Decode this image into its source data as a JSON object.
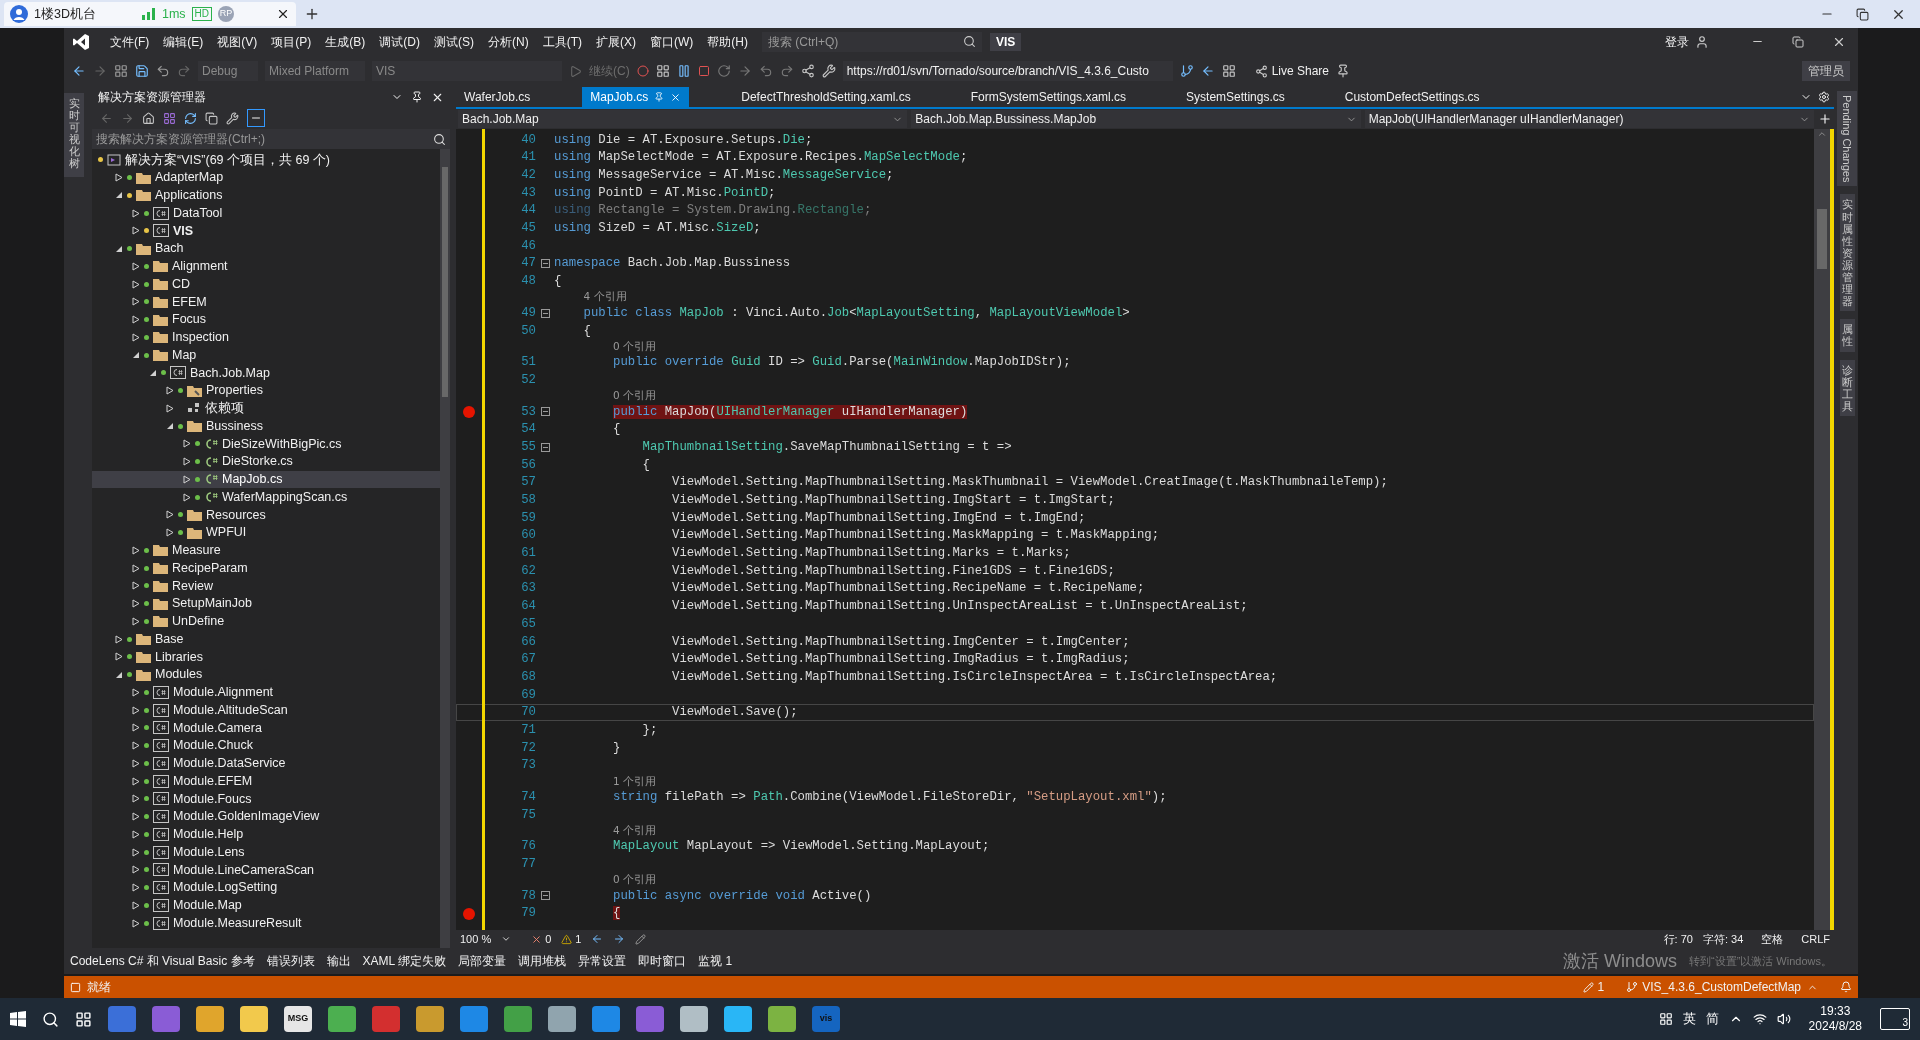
{
  "browser": {
    "tab_title": "1楼3D机台",
    "latency": "1ms",
    "badges": [
      "HD",
      "RP"
    ]
  },
  "menu": {
    "items": [
      "文件(F)",
      "编辑(E)",
      "视图(V)",
      "项目(P)",
      "生成(B)",
      "调试(D)",
      "测试(S)",
      "分析(N)",
      "工具(T)",
      "扩展(X)",
      "窗口(W)",
      "帮助(H)"
    ],
    "search_placeholder": "搜索 (Ctrl+Q)",
    "solution_name": "VIS",
    "login": "登录"
  },
  "toolbar": {
    "configuration": "Debug",
    "platform": "Mixed Platform",
    "startup": "VIS",
    "continue": {
      "label": "继续(C)",
      "disabled": true
    },
    "url": "https://rd01/svn/Tornado/source/branch/VIS_4.3.6_Custo",
    "live_share": "Live Share",
    "admin": "管理员"
  },
  "left_strip": "实时可视化树",
  "solution_explorer": {
    "title": "解决方案资源管理器",
    "search_placeholder": "搜索解决方案资源管理器(Ctrl+;)",
    "tree": [
      {
        "label": "解决方案“VIS”(69 个项目，共 69 个)",
        "kind": "solution",
        "color": "#e8c547",
        "selected": false,
        "children": [
          {
            "label": "AdapterMap",
            "kind": "folder",
            "color": "#6cbf4a",
            "selected": false,
            "expanded": false
          },
          {
            "label": "Applications",
            "kind": "folder",
            "color": "#e8c547",
            "selected": false,
            "expanded": true,
            "children": [
              {
                "label": "DataTool",
                "kind": "project",
                "color": "#6cbf4a",
                "selected": false,
                "expanded": false
              },
              {
                "label": "VIS",
                "kind": "project",
                "color": "#e8c547",
                "selected": false,
                "expanded": false,
                "startup": true
              }
            ]
          },
          {
            "label": "Bach",
            "kind": "folder",
            "color": "#6cbf4a",
            "selected": false,
            "expanded": true,
            "children": [
              {
                "label": "Alignment",
                "kind": "folder",
                "color": "#6cbf4a",
                "selected": false,
                "expanded": false
              },
              {
                "label": "CD",
                "kind": "folder",
                "color": "#6cbf4a",
                "selected": false,
                "expanded": false
              },
              {
                "label": "EFEM",
                "kind": "folder",
                "color": "#6cbf4a",
                "selected": false,
                "expanded": false
              },
              {
                "label": "Focus",
                "kind": "folder",
                "color": "#6cbf4a",
                "selected": false,
                "expanded": false
              },
              {
                "label": "Inspection",
                "kind": "folder",
                "color": "#6cbf4a",
                "selected": false,
                "expanded": false
              },
              {
                "label": "Map",
                "kind": "folder",
                "color": "#6cbf4a",
                "selected": false,
                "expanded": true,
                "children": [
                  {
                    "label": "Bach.Job.Map",
                    "kind": "project",
                    "color": "#6cbf4a",
                    "selected": false,
                    "expanded": true,
                    "children": [
                      {
                        "label": "Properties",
                        "kind": "properties",
                        "color": "#6cbf4a",
                        "selected": false,
                        "expanded": false
                      },
                      {
                        "label": "依赖项",
                        "kind": "deps",
                        "selected": false,
                        "expanded": false
                      },
                      {
                        "label": "Bussiness",
                        "kind": "folder",
                        "color": "#6cbf4a",
                        "selected": false,
                        "expanded": true,
                        "children": [
                          {
                            "label": "DieSizeWithBigPic.cs",
                            "kind": "file",
                            "color": "#6cbf4a",
                            "selected": false,
                            "expanded": false
                          },
                          {
                            "label": "DieStorke.cs",
                            "kind": "file",
                            "color": "#6cbf4a",
                            "selected": false,
                            "expanded": false
                          },
                          {
                            "label": "MapJob.cs",
                            "kind": "file",
                            "color": "#6cbf4a",
                            "selected": true,
                            "expanded": false
                          },
                          {
                            "label": "WaferMappingScan.cs",
                            "kind": "file",
                            "color": "#6cbf4a",
                            "selected": false,
                            "expanded": false
                          }
                        ]
                      },
                      {
                        "label": "Resources",
                        "kind": "folder",
                        "color": "#6cbf4a",
                        "selected": false,
                        "expanded": false
                      },
                      {
                        "label": "WPFUI",
                        "kind": "folder",
                        "color": "#6cbf4a",
                        "selected": false,
                        "expanded": false
                      }
                    ]
                  }
                ]
              },
              {
                "label": "Measure",
                "kind": "folder",
                "color": "#6cbf4a",
                "selected": false,
                "expanded": false
              },
              {
                "label": "RecipeParam",
                "kind": "folder",
                "color": "#6cbf4a",
                "selected": false,
                "expanded": false
              },
              {
                "label": "Review",
                "kind": "folder",
                "color": "#6cbf4a",
                "selected": false,
                "expanded": false
              },
              {
                "label": "SetupMainJob",
                "kind": "folder",
                "color": "#6cbf4a",
                "selected": false,
                "expanded": false
              },
              {
                "label": "UnDefine",
                "kind": "folder",
                "color": "#6cbf4a",
                "selected": false,
                "expanded": false
              }
            ]
          },
          {
            "label": "Base",
            "kind": "folder",
            "color": "#6cbf4a",
            "selected": false,
            "expanded": false
          },
          {
            "label": "Libraries",
            "kind": "folder",
            "color": "#6cbf4a",
            "selected": false,
            "expanded": false
          },
          {
            "label": "Modules",
            "kind": "folder",
            "color": "#6cbf4a",
            "selected": false,
            "expanded": true,
            "children": [
              {
                "label": "Module.Alignment",
                "kind": "project",
                "color": "#6cbf4a",
                "selected": false,
                "expanded": false
              },
              {
                "label": "Module.AltitudeScan",
                "kind": "project",
                "color": "#6cbf4a",
                "selected": false,
                "expanded": false
              },
              {
                "label": "Module.Camera",
                "kind": "project",
                "color": "#6cbf4a",
                "selected": false,
                "expanded": false
              },
              {
                "label": "Module.Chuck",
                "kind": "project",
                "color": "#6cbf4a",
                "selected": false,
                "expanded": false
              },
              {
                "label": "Module.DataService",
                "kind": "project",
                "color": "#6cbf4a",
                "selected": false,
                "expanded": false
              },
              {
                "label": "Module.EFEM",
                "kind": "project",
                "color": "#6cbf4a",
                "selected": false,
                "expanded": false
              },
              {
                "label": "Module.Foucs",
                "kind": "project",
                "color": "#6cbf4a",
                "selected": false,
                "expanded": false
              },
              {
                "label": "Module.GoldenImageView",
                "kind": "project",
                "color": "#6cbf4a",
                "selected": false,
                "expanded": false
              },
              {
                "label": "Module.Help",
                "kind": "project",
                "color": "#6cbf4a",
                "selected": false,
                "expanded": false
              },
              {
                "label": "Module.Lens",
                "kind": "project",
                "color": "#6cbf4a",
                "selected": false,
                "expanded": false
              },
              {
                "label": "Module.LineCameraScan",
                "kind": "project",
                "color": "#6cbf4a",
                "selected": false,
                "expanded": false
              },
              {
                "label": "Module.LogSetting",
                "kind": "project",
                "color": "#6cbf4a",
                "selected": false,
                "expanded": false
              },
              {
                "label": "Module.Map",
                "kind": "project",
                "color": "#6cbf4a",
                "selected": false,
                "expanded": false
              },
              {
                "label": "Module.MeasureResult",
                "kind": "project",
                "color": "#6cbf4a",
                "selected": false,
                "expanded": false
              }
            ]
          }
        ]
      }
    ]
  },
  "editor": {
    "tabs": [
      {
        "label": "WaferJob.cs",
        "selected": false
      },
      {
        "label": "MapJob.cs",
        "selected": true
      },
      {
        "label": "DefectThresholdSetting.xaml.cs",
        "selected": false
      },
      {
        "label": "FormSystemSettings.xaml.cs",
        "selected": false
      },
      {
        "label": "SystemSettings.cs",
        "selected": false
      },
      {
        "label": "CustomDefectSettings.cs",
        "selected": false
      }
    ],
    "nav": [
      "Bach.Job.Map",
      "Bach.Job.Map.Bussiness.MapJob",
      "MapJob(UIHandlerManager uIHandlerManager)"
    ],
    "lines": [
      {
        "num": "40",
        "tokens": [
          {
            "kind": "keyword",
            "text": "using"
          },
          {
            "kind": "plain",
            "text": " Die = AT.Exposure.Setups."
          },
          {
            "kind": "type",
            "text": "Die"
          },
          {
            "kind": "plain",
            "text": ";"
          }
        ]
      },
      {
        "num": "41",
        "tokens": [
          {
            "kind": "keyword",
            "text": "using"
          },
          {
            "kind": "plain",
            "text": " MapSelectMode = AT.Exposure.Recipes."
          },
          {
            "kind": "type",
            "text": "MapSelectMode"
          },
          {
            "kind": "plain",
            "text": ";"
          }
        ]
      },
      {
        "num": "42",
        "tokens": [
          {
            "kind": "keyword",
            "text": "using"
          },
          {
            "kind": "plain",
            "text": " MessageService = AT.Misc."
          },
          {
            "kind": "type",
            "text": "MessageService"
          },
          {
            "kind": "plain",
            "text": ";"
          }
        ]
      },
      {
        "num": "43",
        "tokens": [
          {
            "kind": "keyword",
            "text": "using"
          },
          {
            "kind": "plain",
            "text": " PointD = AT.Misc."
          },
          {
            "kind": "type",
            "text": "PointD"
          },
          {
            "kind": "plain",
            "text": ";"
          }
        ]
      },
      {
        "num": "44",
        "faded": true,
        "tokens": [
          {
            "kind": "keyword",
            "text": "using"
          },
          {
            "kind": "plain",
            "text": " Rectangle = System.Drawing."
          },
          {
            "kind": "type",
            "text": "Rectangle"
          },
          {
            "kind": "plain",
            "text": ";"
          }
        ]
      },
      {
        "num": "45",
        "tokens": [
          {
            "kind": "keyword",
            "text": "using"
          },
          {
            "kind": "plain",
            "text": " SizeD = AT.Misc."
          },
          {
            "kind": "type",
            "text": "SizeD"
          },
          {
            "kind": "plain",
            "text": ";"
          }
        ]
      },
      {
        "num": "46"
      },
      {
        "num": "47",
        "fold": true,
        "tokens": [
          {
            "kind": "keyword",
            "text": "namespace"
          },
          {
            "kind": "plain",
            "text": " Bach.Job.Map.Bussiness"
          }
        ]
      },
      {
        "num": "48",
        "tokens": [
          {
            "kind": "plain",
            "text": "{"
          }
        ]
      },
      {
        "num": "49",
        "refs": "4 个引用",
        "fold": true,
        "tokens": [
          {
            "kind": "keyword",
            "text": "    public class"
          },
          {
            "kind": "type",
            "text": " MapJob"
          },
          {
            "kind": "plain",
            "text": " : Vinci.Auto."
          },
          {
            "kind": "type",
            "text": "Job"
          },
          {
            "kind": "plain",
            "text": "<"
          },
          {
            "kind": "type",
            "text": "MapLayoutSetting"
          },
          {
            "kind": "plain",
            "text": ", "
          },
          {
            "kind": "type",
            "text": "MapLayoutViewModel"
          },
          {
            "kind": "plain",
            "text": ">"
          }
        ]
      },
      {
        "num": "50",
        "tokens": [
          {
            "kind": "plain",
            "text": "    {"
          }
        ]
      },
      {
        "num": "51",
        "refs": "0 个引用",
        "tokens": [
          {
            "kind": "keyword",
            "text": "        public override"
          },
          {
            "kind": "type",
            "text": " Guid"
          },
          {
            "kind": "plain",
            "text": " ID => "
          },
          {
            "kind": "type",
            "text": "Guid"
          },
          {
            "kind": "plain",
            "text": ".Parse("
          },
          {
            "kind": "type",
            "text": "MainWindow"
          },
          {
            "kind": "plain",
            "text": ".MapJobIDStr);"
          }
        ]
      },
      {
        "num": "52"
      },
      {
        "num": "53",
        "refs": "0 个引用",
        "fold": true,
        "breakpoint": true,
        "tokens": [
          {
            "kind": "keyword",
            "text": "        public"
          },
          {
            "kind": "plain",
            "text": " MapJob("
          },
          {
            "kind": "type",
            "text": "UIHandlerManager"
          },
          {
            "kind": "plain",
            "text": " uIHandlerManager)"
          }
        ]
      },
      {
        "num": "54",
        "tokens": [
          {
            "kind": "plain",
            "text": "        {"
          }
        ]
      },
      {
        "num": "55",
        "fold": true,
        "tokens": [
          {
            "kind": "type",
            "text": "            MapThumbnailSetting"
          },
          {
            "kind": "plain",
            "text": ".SaveMapThumbnailSetting = t =>"
          }
        ]
      },
      {
        "num": "56",
        "tokens": [
          {
            "kind": "plain",
            "text": "            {"
          }
        ]
      },
      {
        "num": "57",
        "tokens": [
          {
            "kind": "plain",
            "text": "                ViewModel.Setting.MapThumbnailSetting.MaskThumbnail = ViewModel.CreatImage(t.MaskThumbnaileTemp);"
          }
        ]
      },
      {
        "num": "58",
        "tokens": [
          {
            "kind": "plain",
            "text": "                ViewModel.Setting.MapThumbnailSetting.ImgStart = t.ImgStart;"
          }
        ]
      },
      {
        "num": "59",
        "tokens": [
          {
            "kind": "plain",
            "text": "                ViewModel.Setting.MapThumbnailSetting.ImgEnd = t.ImgEnd;"
          }
        ]
      },
      {
        "num": "60",
        "tokens": [
          {
            "kind": "plain",
            "text": "                ViewModel.Setting.MapThumbnailSetting.MaskMapping = t.MaskMapping;"
          }
        ]
      },
      {
        "num": "61",
        "tokens": [
          {
            "kind": "plain",
            "text": "                ViewModel.Setting.MapThumbnailSetting.Marks = t.Marks;"
          }
        ]
      },
      {
        "num": "62",
        "tokens": [
          {
            "kind": "plain",
            "text": "                ViewModel.Setting.MapThumbnailSetting.Fine1GDS = t.Fine1GDS;"
          }
        ]
      },
      {
        "num": "63",
        "tokens": [
          {
            "kind": "plain",
            "text": "                ViewModel.Setting.MapThumbnailSetting.RecipeName = t.RecipeName;"
          }
        ]
      },
      {
        "num": "64",
        "tokens": [
          {
            "kind": "plain",
            "text": "                ViewModel.Setting.MapThumbnailSetting.UnInspectAreaList = t.UnInspectAreaList;"
          }
        ]
      },
      {
        "num": "65"
      },
      {
        "num": "66",
        "tokens": [
          {
            "kind": "plain",
            "text": "                ViewModel.Setting.MapThumbnailSetting.ImgCenter = t.ImgCenter;"
          }
        ]
      },
      {
        "num": "67",
        "tokens": [
          {
            "kind": "plain",
            "text": "                ViewModel.Setting.MapThumbnailSetting.ImgRadius = t.ImgRadius;"
          }
        ]
      },
      {
        "num": "68",
        "tokens": [
          {
            "kind": "plain",
            "text": "                ViewModel.Setting.MapThumbnailSetting.IsCircleInspectArea = t.IsCircleInspectArea;"
          }
        ]
      },
      {
        "num": "69"
      },
      {
        "num": "70",
        "current": true,
        "tokens": [
          {
            "kind": "plain",
            "text": "                ViewModel.Save();"
          }
        ]
      },
      {
        "num": "71",
        "tokens": [
          {
            "kind": "plain",
            "text": "            };"
          }
        ]
      },
      {
        "num": "72",
        "tokens": [
          {
            "kind": "plain",
            "text": "        }"
          }
        ]
      },
      {
        "num": "73"
      },
      {
        "num": "74",
        "refs": "1 个引用",
        "tokens": [
          {
            "kind": "keyword",
            "text": "        string"
          },
          {
            "kind": "plain",
            "text": " filePath => "
          },
          {
            "kind": "type",
            "text": "Path"
          },
          {
            "kind": "plain",
            "text": ".Combine(ViewModel.FileStoreDir, "
          },
          {
            "kind": "string",
            "text": "\"SetupLayout.xml\""
          },
          {
            "kind": "plain",
            "text": ");"
          }
        ]
      },
      {
        "num": "75"
      },
      {
        "num": "76",
        "refs": "4 个引用",
        "tokens": [
          {
            "kind": "type",
            "text": "        MapLayout"
          },
          {
            "kind": "plain",
            "text": " MapLayout => ViewModel.Setting.MapLayout;"
          }
        ]
      },
      {
        "num": "77"
      },
      {
        "num": "78",
        "refs": "0 个引用",
        "fold": true,
        "tokens": [
          {
            "kind": "keyword",
            "text": "        public async override void"
          },
          {
            "kind": "plain",
            "text": " Active()"
          }
        ]
      },
      {
        "num": "79",
        "breakpoint": true,
        "tokens": [
          {
            "kind": "plain",
            "text": "        {"
          }
        ]
      }
    ],
    "status": {
      "zoom": "100 %",
      "errors": "0",
      "warnings": "1",
      "line": "行: 70",
      "char": "字符: 34",
      "spaces": "空格",
      "eol": "CRLF"
    }
  },
  "right_strip": [
    {
      "label": "Pending Changes",
      "kind": "latin"
    },
    {
      "label": "实时属性资源管理器",
      "kind": "cjk"
    },
    {
      "label": "属性",
      "kind": "cjk"
    },
    {
      "label": "诊断工具",
      "kind": "cjk"
    }
  ],
  "bottom_tabs": [
    "CodeLens C# 和 Visual Basic 参考",
    "错误列表",
    "输出",
    "XAML 绑定失败",
    "局部变量",
    "调用堆栈",
    "异常设置",
    "即时窗口",
    "监视 1"
  ],
  "activation": {
    "title": "激活 Windows",
    "hint": "转到“设置”以激活 Windows。"
  },
  "status_bar": {
    "ready": "就绪",
    "changes": "1",
    "branch": "VIS_4.3.6_CustomDefectMap"
  },
  "taskbar": {
    "apps": [
      {
        "color": "#3b6fd8"
      },
      {
        "color": "#8a5cd6"
      },
      {
        "color": "#e0a52c"
      },
      {
        "color": "#f2c94c"
      },
      {
        "color": "#e6e6e6",
        "label": "MSG"
      },
      {
        "color": "#4caf50"
      },
      {
        "color": "#d32f2f"
      },
      {
        "color": "#c99a2e"
      },
      {
        "color": "#1e88e5"
      },
      {
        "color": "#43a047"
      },
      {
        "color": "#90a4ae"
      },
      {
        "color": "#1e88e5"
      },
      {
        "color": "#8a5cd6"
      },
      {
        "color": "#b0bec5"
      },
      {
        "color": "#29b6f6"
      },
      {
        "color": "#7cb342"
      },
      {
        "color": "#1565c0",
        "label": "vis"
      }
    ],
    "ime": [
      "英",
      "简"
    ],
    "time": "19:33",
    "date": "2024/8/28",
    "notifications": "3"
  }
}
